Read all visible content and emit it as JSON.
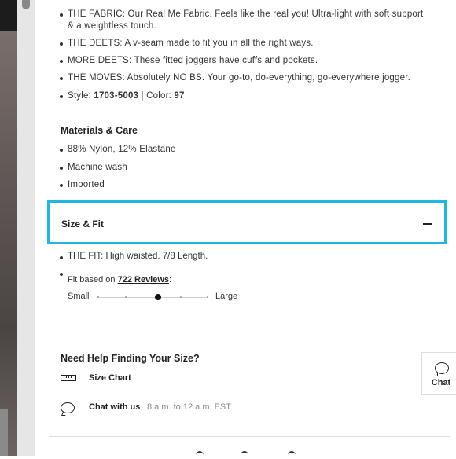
{
  "product_details": {
    "bullets": [
      {
        "text": "THE FABRIC: Our Real Me Fabric. Feels like the real you! Ultra-light with soft support & a weightless touch."
      },
      {
        "text": "THE DEETS: A v-seam made to fit you in all the right ways."
      },
      {
        "text": "MORE DEETS: These fitted joggers have cuffs and pockets."
      },
      {
        "text": "THE MOVES: Absolutely NO BS. Your go-to, do-everything, go-everywhere jogger."
      }
    ],
    "style_label": "Style: ",
    "style_value": "1703-5003",
    "color_separator": " | Color: ",
    "color_value": "97"
  },
  "materials": {
    "title": "Materials & Care",
    "items": [
      "88% Nylon, 12% Elastane",
      "Machine wash",
      "Imported"
    ]
  },
  "size_fit": {
    "title": "Size & Fit",
    "expanded": true,
    "fit_text": "THE FIT: High waisted. 7/8 Length.",
    "fit_based_prefix": "Fit based on ",
    "reviews_link": "722 Reviews",
    "fit_based_suffix": ":",
    "scale_min_label": "Small",
    "scale_max_label": "Large",
    "scale_value": 0.55
  },
  "help": {
    "title": "Need Help Finding Your Size?",
    "size_chart_label": "Size Chart",
    "chat_label": "Chat with us",
    "chat_hours": "8 a.m. to 12 a.m. EST"
  },
  "chat_widget": {
    "label": "Chat",
    "icon": "chat-bubble-icon"
  },
  "colors": {
    "accent_outline": "#1db7e0",
    "text": "#222222",
    "muted": "#888888"
  }
}
